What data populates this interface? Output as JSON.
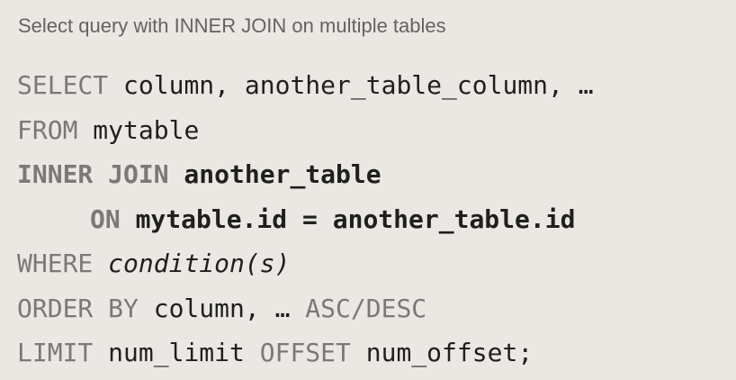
{
  "caption": "Select query with INNER JOIN on multiple tables",
  "query": {
    "select": {
      "keyword": "SELECT",
      "text": " column, another_table_column, …"
    },
    "from": {
      "keyword": "FROM",
      "text": " mytable"
    },
    "inner_join": {
      "keyword": "INNER JOIN",
      "text": " another_table"
    },
    "on": {
      "keyword": "ON",
      "text": " mytable.id = another_table.id"
    },
    "where": {
      "keyword": "WHERE",
      "condition": "condition(s)"
    },
    "order_by": {
      "keyword": "ORDER BY",
      "text": " column, … ",
      "direction": "ASC/DESC"
    },
    "limit": {
      "keyword": "LIMIT",
      "value": " num_limit ",
      "offset_keyword": "OFFSET",
      "offset_value": " num_offset;"
    }
  },
  "colors": {
    "background": "#ebe8e3",
    "keyword": "#7b7876",
    "text": "#1f1f1f",
    "caption": "#666260"
  }
}
